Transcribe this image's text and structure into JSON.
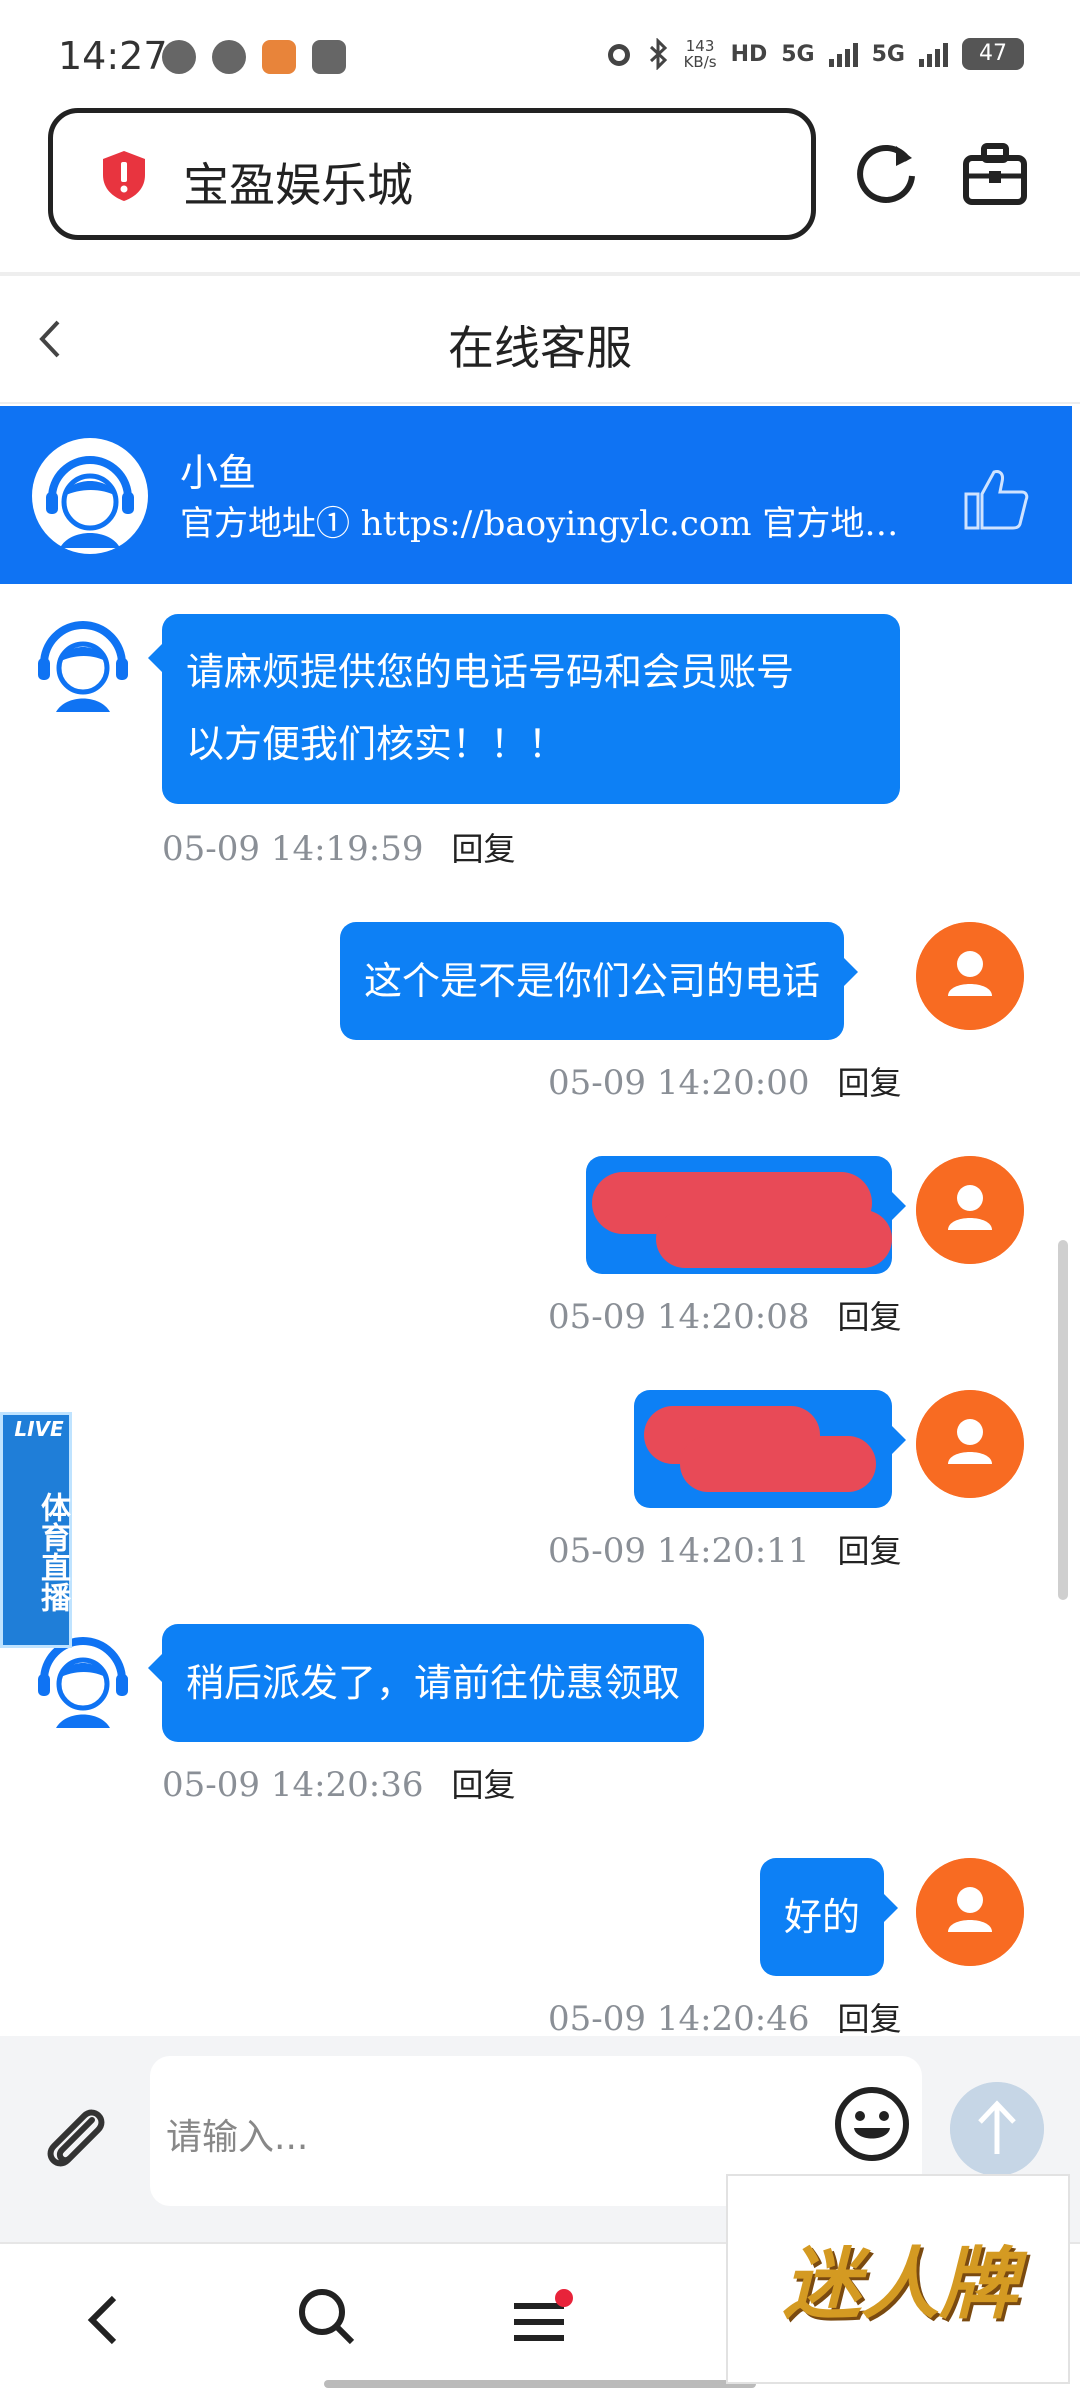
{
  "status_bar": {
    "time": "14:27",
    "net_speed_value": "143",
    "net_speed_unit": "KB/s",
    "hd_label": "HD",
    "network_1": "5G",
    "network_2": "5G",
    "battery": "47"
  },
  "browser": {
    "site_title": "宝盈娱乐城",
    "icons": [
      "security-warning-icon",
      "reload-icon",
      "briefcase-icon"
    ]
  },
  "header": {
    "title": "在线客服"
  },
  "agent": {
    "name": "小鱼",
    "notice": "官方地址① https://baoyingylc.com 官方地址②..."
  },
  "messages": [
    {
      "side": "left",
      "lines": [
        "请麻烦提供您的电话号码和会员账号",
        "以方便我们核实！！！"
      ],
      "time": "05-09 14:19:59",
      "reply": "回复"
    },
    {
      "side": "right",
      "text": "这个是不是你们公司的电话",
      "time": "05-09 14:20:00",
      "reply": "回复"
    },
    {
      "side": "right",
      "text": "",
      "redacted": true,
      "time": "05-09 14:20:08",
      "reply": "回复"
    },
    {
      "side": "right",
      "text": "",
      "redacted": true,
      "time": "05-09 14:20:11",
      "reply": "回复"
    },
    {
      "side": "left",
      "text": "稍后派发了，请前往优惠领取",
      "time": "05-09 14:20:36",
      "reply": "回复"
    },
    {
      "side": "right",
      "text": "好的",
      "time": "05-09 14:20:46",
      "reply": "回复"
    }
  ],
  "live_badge": {
    "tag": "LIVE",
    "text": "体育直播"
  },
  "input": {
    "placeholder": "请输入..."
  },
  "watermark": {
    "text": "迷人牌"
  },
  "colors": {
    "primary_blue": "#0f73f3",
    "bubble_blue": "#0d80f5",
    "user_avatar": "#f86b22",
    "redaction": "#e84a57"
  }
}
